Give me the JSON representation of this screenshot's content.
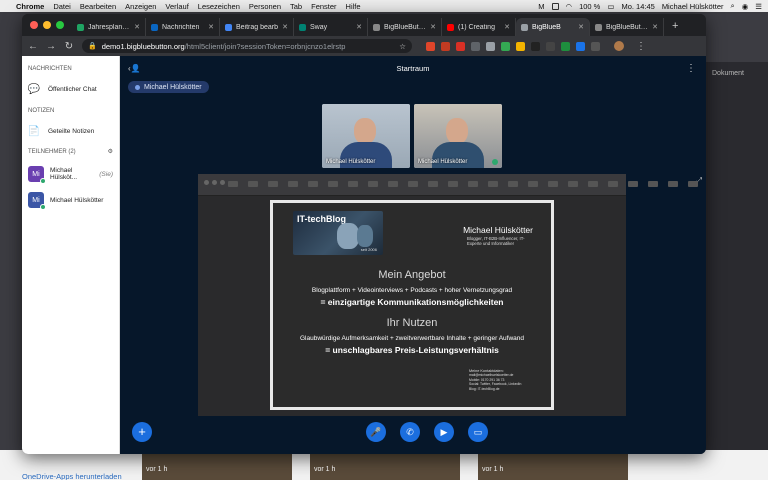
{
  "menubar": {
    "app": "Chrome",
    "items": [
      "Datei",
      "Bearbeiten",
      "Anzeigen",
      "Verlauf",
      "Lesezeichen",
      "Personen",
      "Tab",
      "Fenster",
      "Hilfe"
    ],
    "battery": "100 %",
    "clock": "Mo. 14:45",
    "user": "Michael Hülskötter"
  },
  "background_app": {
    "side_text": "Dokument",
    "onedrive": "OneDrive-Apps herunterladen",
    "tiles": [
      "vor 1 h",
      "vor 1 h",
      "vor 1 h"
    ]
  },
  "tabs": [
    {
      "label": "Jahresplanung",
      "color": "#1fa463"
    },
    {
      "label": "Nachrichten",
      "color": "#0a66c2"
    },
    {
      "label": "Beitrag bearb",
      "color": "#4285f4"
    },
    {
      "label": "Sway",
      "color": "#008272"
    },
    {
      "label": "BigBlueButton",
      "color": "#888888"
    },
    {
      "label": "(1) Creating",
      "color": "#ff0000"
    },
    {
      "label": "BigBlueB",
      "color": "#9aa0a6",
      "active": true
    },
    {
      "label": "BigBlueButton",
      "color": "#888888"
    }
  ],
  "toolbar": {
    "url_host": "demo1.bigbluebutton.org",
    "url_path": "/html5client/join?sessionToken=orbnjcnzo1elrstp"
  },
  "sidebar": {
    "messages_heading": "NACHRICHTEN",
    "public_chat": "Öffentlicher Chat",
    "notes_heading": "NOTIZEN",
    "shared_notes": "Geteilte Notizen",
    "participants_heading": "TEILNEHMER (2)",
    "users": [
      {
        "initials": "Mi",
        "name": "Michael Hülsköt...",
        "you": "(Sie)"
      },
      {
        "initials": "Mi",
        "name": "Michael Hülskötter",
        "you": ""
      }
    ]
  },
  "main": {
    "room_title": "Startraum",
    "talking_pill": "Michael Hülskötter",
    "videos": [
      "Michael Hülskötter",
      "Michael Hülskötter"
    ]
  },
  "slide": {
    "logo_text": "IT-techBlog",
    "logo_sub": "seit 2006",
    "name": "Michael Hülskötter",
    "role": "Blogger, IT-B2B-Influencer, IT-Experte und Informatiker",
    "heading1": "Mein Angebot",
    "text1": "Blogplattform + Videointerviews + Podcasts + hoher Vernetzungsgrad",
    "bold1": "= einzigartige Kommunikationsmöglichkeiten",
    "heading2": "Ihr Nutzen",
    "text2": "Glaubwürdige Aufmerksamkeit + zweitverwertbare Inhalte + geringer Aufwand",
    "bold2": "= unschlagbares Preis-Leistungsverhältnis",
    "contact_title": "Meine Kontaktdaten:",
    "contact_lines": [
      "mail@michaelhuelskoetter.de",
      "Mobile: 0170 291 36 73",
      "Social: Twitter, Facebook, LinkedIn",
      "Blog: IT-techBlog.de"
    ]
  },
  "colors": {
    "accent": "#1b6ede",
    "main_bg": "#06172a",
    "status_green": "#2ea86e"
  }
}
